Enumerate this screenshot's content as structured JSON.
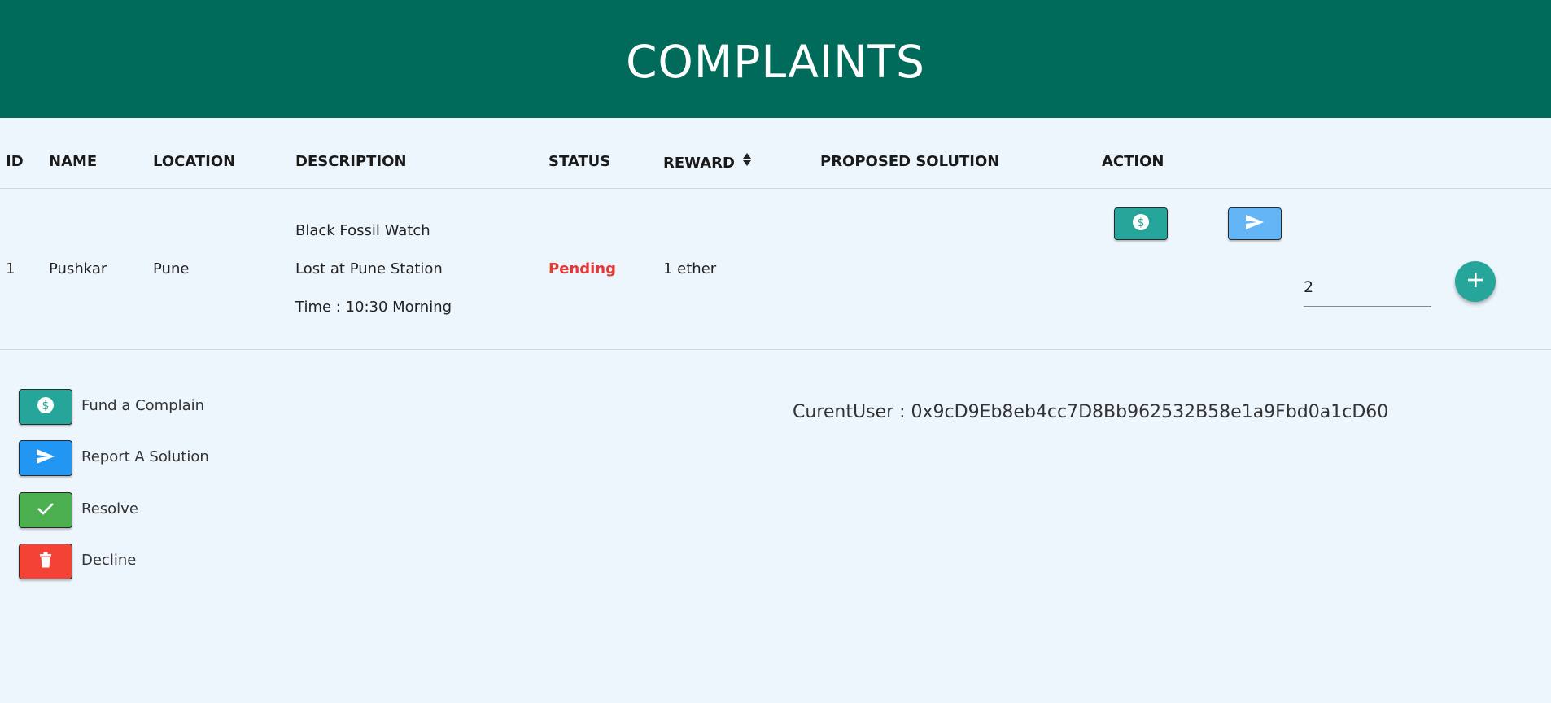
{
  "header": {
    "title": "COMPLAINTS"
  },
  "table": {
    "columns": {
      "id": "ID",
      "name": "NAME",
      "location": "LOCATION",
      "description": "DESCRIPTION",
      "status": "STATUS",
      "reward": "REWARD",
      "proposed_solution": "PROPOSED SOLUTION",
      "action": "ACTION"
    },
    "rows": [
      {
        "id": "1",
        "name": "Pushkar",
        "location": "Pune",
        "description": [
          "Black Fossil Watch",
          "Lost at Pune Station",
          "Time : 10:30 Morning"
        ],
        "status": "Pending",
        "reward": "1 ether",
        "amount_value": "2"
      }
    ]
  },
  "legend": {
    "fund": "Fund a Complain",
    "report": "Report A Solution",
    "resolve": "Resolve",
    "decline": "Decline"
  },
  "current_user": "CurentUser : 0x9cD9Eb8eb4cc7D8Bb962532B58e1a9Fbd0a1cD60",
  "colors": {
    "header_bg": "#006a5b",
    "fund": "#26a69a",
    "report": "#2196f3",
    "report_light": "#64b5f6",
    "resolve": "#4caf50",
    "decline": "#f44336",
    "status_pending": "#e53935"
  },
  "icons": {
    "fund": "dollar-icon",
    "report": "send-icon",
    "resolve": "check-icon",
    "decline": "trash-icon",
    "add": "plus-icon",
    "sort": "sort-icon"
  }
}
